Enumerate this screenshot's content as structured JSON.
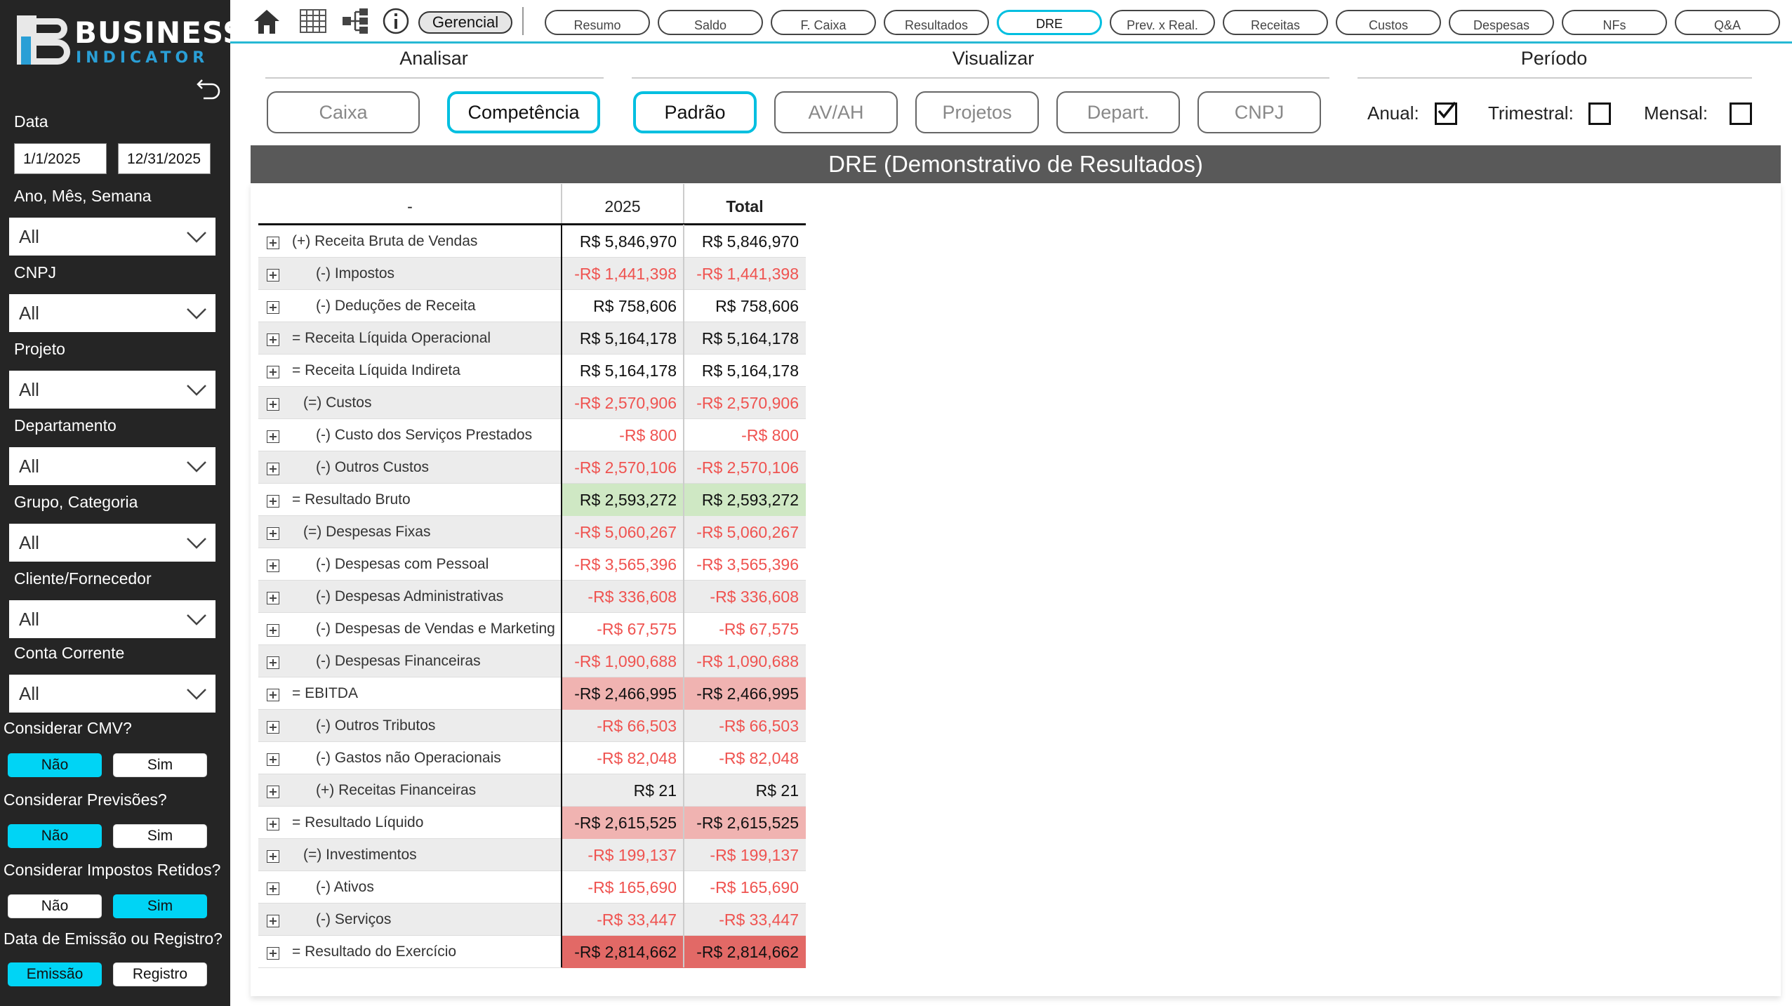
{
  "sidebar": {
    "logo_line1": "BUSINESS",
    "logo_line2": "INDICATOR",
    "date_label": "Data",
    "date_start": "1/1/2025",
    "date_end": "12/31/2025",
    "filters": [
      {
        "label": "Ano, Mês, Semana",
        "value": "All"
      },
      {
        "label": "CNPJ",
        "value": "All"
      },
      {
        "label": "Projeto",
        "value": "All"
      },
      {
        "label": "Departamento",
        "value": "All"
      },
      {
        "label": "Grupo, Categoria",
        "value": "All"
      },
      {
        "label": "Cliente/Fornecedor",
        "value": "All"
      },
      {
        "label": "Conta Corrente",
        "value": "All"
      }
    ],
    "toggles": [
      {
        "label": "Considerar CMV?",
        "left": "Não",
        "right": "Sim",
        "active": "left"
      },
      {
        "label": "Considerar Previsões?",
        "left": "Não",
        "right": "Sim",
        "active": "left"
      },
      {
        "label": "Considerar Impostos Retidos?",
        "left": "Não",
        "right": "Sim",
        "active": "right"
      },
      {
        "label": "Data de Emissão ou Registro?",
        "left": "Emissão",
        "right": "Registro",
        "active": "left"
      }
    ]
  },
  "topbar": {
    "icons": [
      "home-icon",
      "table-icon",
      "hierarchy-icon",
      "info-icon"
    ],
    "gerencial": "Gerencial",
    "tabs": [
      "Resumo",
      "Saldo",
      "F. Caixa",
      "Resultados",
      "DRE",
      "Prev. x Real.",
      "Receitas",
      "Custos",
      "Despesas",
      "NFs",
      "Q&A"
    ],
    "active_tab": "DRE"
  },
  "controls": {
    "analisar_title": "Analisar",
    "visualizar_title": "Visualizar",
    "periodo_title": "Período",
    "analisar": [
      "Caixa",
      "Competência"
    ],
    "analisar_active": "Competência",
    "visualizar": [
      "Padrão",
      "AV/AH",
      "Projetos",
      "Depart.",
      "CNPJ"
    ],
    "visualizar_active": "Padrão",
    "periodo": [
      {
        "label": "Anual:",
        "checked": true
      },
      {
        "label": "Trimestral:",
        "checked": false
      },
      {
        "label": "Mensal:",
        "checked": false
      }
    ]
  },
  "dre": {
    "title": "DRE (Demonstrativo de Resultados)",
    "col_headers": [
      "-",
      "2025",
      "Total"
    ],
    "accent_color": "#00bfe0",
    "rows": [
      {
        "label": "(+) Receita Bruta de Vendas",
        "indent": 0,
        "v2025": "R$ 5,846,970",
        "total": "R$ 5,846,970",
        "sign": "pos",
        "hl": ""
      },
      {
        "label": "(-) Impostos",
        "indent": 2,
        "v2025": "-R$ 1,441,398",
        "total": "-R$ 1,441,398",
        "sign": "neg",
        "hl": ""
      },
      {
        "label": "(-) Deduções de Receita",
        "indent": 2,
        "v2025": "R$ 758,606",
        "total": "R$ 758,606",
        "sign": "pos",
        "hl": ""
      },
      {
        "label": "= Receita Líquida Operacional",
        "indent": 0,
        "v2025": "R$ 5,164,178",
        "total": "R$ 5,164,178",
        "sign": "pos",
        "hl": ""
      },
      {
        "label": "= Receita Líquida Indireta",
        "indent": 0,
        "v2025": "R$ 5,164,178",
        "total": "R$ 5,164,178",
        "sign": "pos",
        "hl": ""
      },
      {
        "label": "(=) Custos",
        "indent": 1,
        "v2025": "-R$ 2,570,906",
        "total": "-R$ 2,570,906",
        "sign": "neg",
        "hl": ""
      },
      {
        "label": "(-) Custo dos Serviços Prestados",
        "indent": 2,
        "v2025": "-R$ 800",
        "total": "-R$ 800",
        "sign": "neg",
        "hl": ""
      },
      {
        "label": "(-) Outros Custos",
        "indent": 2,
        "v2025": "-R$ 2,570,106",
        "total": "-R$ 2,570,106",
        "sign": "neg",
        "hl": ""
      },
      {
        "label": "= Resultado Bruto",
        "indent": 0,
        "v2025": "R$ 2,593,272",
        "total": "R$ 2,593,272",
        "sign": "pos",
        "hl": "green"
      },
      {
        "label": "(=) Despesas Fixas",
        "indent": 1,
        "v2025": "-R$ 5,060,267",
        "total": "-R$ 5,060,267",
        "sign": "neg",
        "hl": ""
      },
      {
        "label": "(-) Despesas com Pessoal",
        "indent": 2,
        "v2025": "-R$ 3,565,396",
        "total": "-R$ 3,565,396",
        "sign": "neg",
        "hl": ""
      },
      {
        "label": "(-) Despesas Administrativas",
        "indent": 2,
        "v2025": "-R$ 336,608",
        "total": "-R$ 336,608",
        "sign": "neg",
        "hl": ""
      },
      {
        "label": "(-) Despesas de Vendas e Marketing",
        "indent": 2,
        "v2025": "-R$ 67,575",
        "total": "-R$ 67,575",
        "sign": "neg",
        "hl": ""
      },
      {
        "label": "(-) Despesas Financeiras",
        "indent": 2,
        "v2025": "-R$ 1,090,688",
        "total": "-R$ 1,090,688",
        "sign": "neg",
        "hl": ""
      },
      {
        "label": "= EBITDA",
        "indent": 0,
        "v2025": "-R$ 2,466,995",
        "total": "-R$ 2,466,995",
        "sign": "negdark",
        "hl": "pink"
      },
      {
        "label": "(-) Outros Tributos",
        "indent": 2,
        "v2025": "-R$ 66,503",
        "total": "-R$ 66,503",
        "sign": "neg",
        "hl": ""
      },
      {
        "label": "(-) Gastos não Operacionais",
        "indent": 2,
        "v2025": "-R$ 82,048",
        "total": "-R$ 82,048",
        "sign": "neg",
        "hl": ""
      },
      {
        "label": "(+) Receitas Financeiras",
        "indent": 2,
        "v2025": "R$ 21",
        "total": "R$ 21",
        "sign": "pos",
        "hl": ""
      },
      {
        "label": "= Resultado Líquido",
        "indent": 0,
        "v2025": "-R$ 2,615,525",
        "total": "-R$ 2,615,525",
        "sign": "negdark",
        "hl": "pink"
      },
      {
        "label": "(=) Investimentos",
        "indent": 1,
        "v2025": "-R$ 199,137",
        "total": "-R$ 199,137",
        "sign": "neg",
        "hl": ""
      },
      {
        "label": "(-) Ativos",
        "indent": 2,
        "v2025": "-R$ 165,690",
        "total": "-R$ 165,690",
        "sign": "neg",
        "hl": ""
      },
      {
        "label": "(-) Serviços",
        "indent": 2,
        "v2025": "-R$ 33,447",
        "total": "-R$ 33,447",
        "sign": "neg",
        "hl": ""
      },
      {
        "label": "= Resultado do Exercício",
        "indent": 0,
        "v2025": "-R$ 2,814,662",
        "total": "-R$ 2,814,662",
        "sign": "negdark",
        "hl": "red"
      }
    ]
  }
}
